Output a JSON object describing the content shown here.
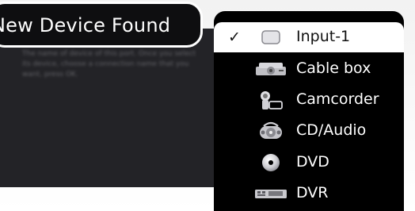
{
  "dialog": {
    "title": "New Device Found",
    "body_text": "The name of device of this port. Once you select its device, choose a connection name that you want, press OK."
  },
  "device_menu": {
    "items": [
      {
        "label": "Input-1",
        "icon": "input-icon",
        "selected": true
      },
      {
        "label": "Cable box",
        "icon": "cable-box-icon",
        "selected": false
      },
      {
        "label": "Camcorder",
        "icon": "camcorder-icon",
        "selected": false
      },
      {
        "label": "CD/Audio",
        "icon": "cd-audio-icon",
        "selected": false
      },
      {
        "label": "DVD",
        "icon": "dvd-icon",
        "selected": false
      },
      {
        "label": "DVR",
        "icon": "dvr-icon",
        "selected": false
      }
    ],
    "check_glyph": "✓"
  },
  "colors": {
    "menu_bg": "#000000",
    "selected_bg": "#ffffff",
    "dialog_bg": "#232327"
  }
}
